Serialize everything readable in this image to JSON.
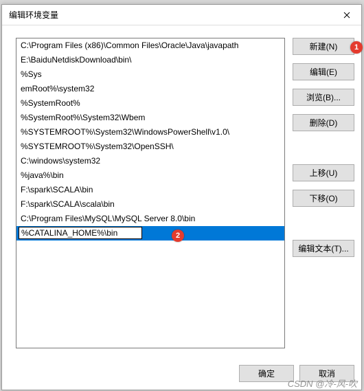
{
  "dialog": {
    "title": "编辑环境变量",
    "close": "✕"
  },
  "path_entries": [
    "C:\\Program Files (x86)\\Common Files\\Oracle\\Java\\javapath",
    "E:\\BaiduNetdiskDownload\\bin\\",
    "%Sys",
    "emRoot%\\system32",
    "%SystemRoot%",
    "%SystemRoot%\\System32\\Wbem",
    "%SYSTEMROOT%\\System32\\WindowsPowerShell\\v1.0\\",
    "%SYSTEMROOT%\\System32\\OpenSSH\\",
    "C:\\windows\\system32",
    "%java%\\bin",
    "F:\\spark\\SCALA\\bin",
    "F:\\spark\\SCALA\\scala\\bin",
    "C:\\Program Files\\MySQL\\MySQL Server 8.0\\bin"
  ],
  "editing_entry": "%CATALINA_HOME%\\bin",
  "buttons": {
    "new": "新建(N)",
    "edit": "编辑(E)",
    "browse": "浏览(B)...",
    "delete": "删除(D)",
    "move_up": "上移(U)",
    "move_down": "下移(O)",
    "edit_text": "编辑文本(T)...",
    "ok": "确定",
    "cancel": "取消"
  },
  "annotations": {
    "a1": "1",
    "a2": "2"
  },
  "watermark": "CSDN @冷-风-吹"
}
